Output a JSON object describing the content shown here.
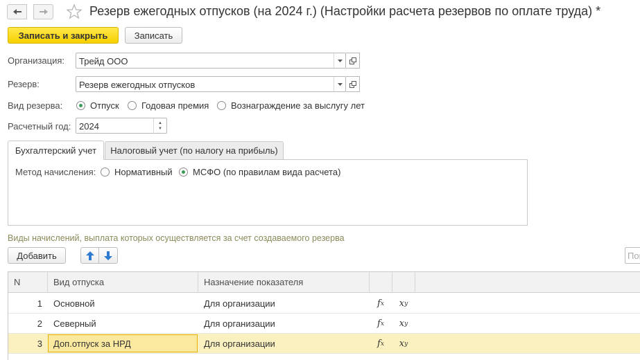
{
  "header": {
    "title": "Резерв ежегодных отпусков (на 2024 г.) (Настройки расчета резервов по оплате труда) *"
  },
  "toolbar": {
    "save_close_label": "Записать и закрыть",
    "save_label": "Записать"
  },
  "form": {
    "organization_label": "Организация:",
    "organization_value": "Трейд ООО",
    "reserve_label": "Резерв:",
    "reserve_value": "Резерв ежегодных отпусков",
    "reserve_type_label": "Вид резерва:",
    "reserve_type_options": [
      "Отпуск",
      "Годовая премия",
      "Вознаграждение за выслугу лет"
    ],
    "reserve_type_selected": "Отпуск",
    "year_label": "Расчетный год:",
    "year_value": "2024"
  },
  "tabs": [
    {
      "label": "Бухгалтерский учет",
      "active": true
    },
    {
      "label": "Налоговый учет (по налогу на прибыль)",
      "active": false
    }
  ],
  "accounting": {
    "method_label": "Метод начисления:",
    "method_options": [
      "Нормативный",
      "МСФО (по правилам вида расчета)"
    ],
    "method_selected": "МСФО (по правилам вида расчета)"
  },
  "accruals": {
    "section_title": "Виды начислений, выплата которых осуществляется за счет создаваемого резерва",
    "add_label": "Добавить",
    "search_placeholder": "Пои",
    "columns": [
      "N",
      "Вид отпуска",
      "Назначение показателя"
    ],
    "rows": [
      {
        "n": "1",
        "vacation": "Основной",
        "purpose": "Для организации",
        "fx": "f",
        "fx_sub": "x",
        "xy": "x",
        "xy_sub": "y"
      },
      {
        "n": "2",
        "vacation": "Северный",
        "purpose": "Для организации",
        "fx": "f",
        "fx_sub": "x",
        "xy": "x",
        "xy_sub": "y"
      },
      {
        "n": "3",
        "vacation": "Доп.отпуск за НРД",
        "purpose": "Для организации",
        "fx": "f",
        "fx_sub": "x",
        "xy": "x",
        "xy_sub": "y",
        "selected": true
      }
    ]
  },
  "colors": {
    "primary_button": "#f7d000",
    "selected_row": "#fbf1c0",
    "radio_dot": "#3c9b5a",
    "section_title": "#8a8a5a"
  }
}
